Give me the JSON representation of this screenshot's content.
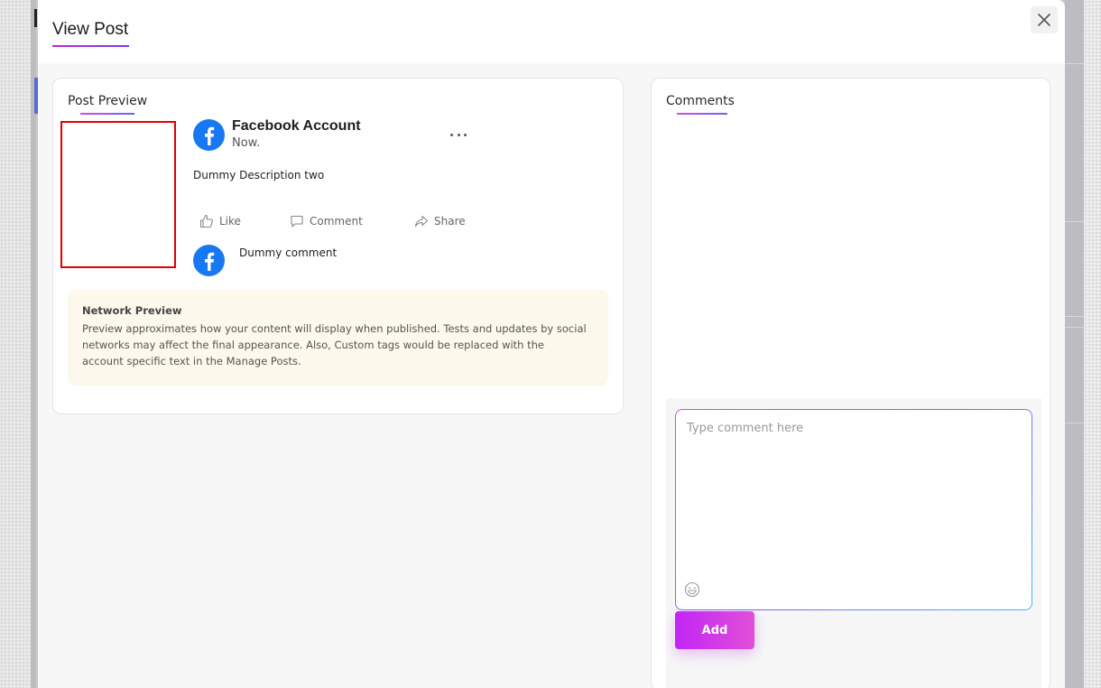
{
  "modal": {
    "title": "View Post"
  },
  "preview": {
    "section_title": "Post Preview",
    "account_name": "Facebook Account",
    "post_time": "Now.",
    "description": "Dummy Description two",
    "actions": {
      "like": "Like",
      "comment": "Comment",
      "share": "Share"
    },
    "comment": "Dummy comment",
    "network_preview": {
      "title": "Network Preview",
      "text": "Preview approximates how your content will display when published. Tests and updates by social networks may affect the final appearance. Also, Custom tags would be replaced with the account specific text in the Manage Posts."
    }
  },
  "comments": {
    "section_title": "Comments",
    "input_placeholder": "Type comment here",
    "add_label": "Add"
  },
  "icons": {
    "close": "close-icon",
    "avatar": "facebook-icon",
    "more": "more-horizontal-icon",
    "like": "thumbs-up-icon",
    "comment": "comment-bubble-icon",
    "share": "share-arrow-icon",
    "emoji": "emoji-icon"
  },
  "colors": {
    "facebook_blue": "#1877f2",
    "accent_pink": "#c026f5",
    "accent_violet": "#7c3aed",
    "notice_bg": "#fdf8ec",
    "highlight_red": "#e00000"
  }
}
